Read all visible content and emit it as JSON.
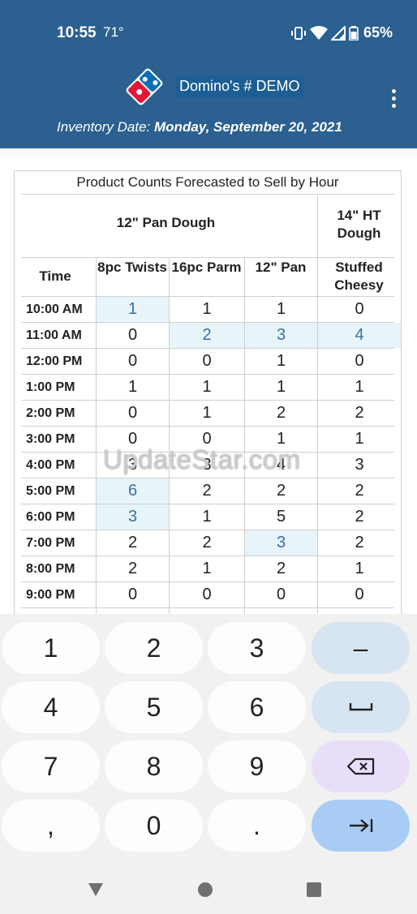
{
  "status_bar": {
    "time": "10:55",
    "temperature": "71°",
    "battery": "65%"
  },
  "header": {
    "store_name": "Domino's # DEMO",
    "inventory_label": "Inventory Date:",
    "inventory_date": "Monday, September 20, 2021"
  },
  "table": {
    "title": "Product Counts Forecasted to Sell by Hour",
    "groups": [
      "12\" Pan Dough",
      "14\" HT Dough"
    ],
    "columns": [
      "Time",
      "8pc Twists",
      "16pc Parm",
      "12\" Pan",
      "Stuffed Cheesy"
    ],
    "rows": [
      {
        "time": "10:00 AM",
        "values": [
          "1",
          "1",
          "1",
          "0"
        ],
        "highlight": [
          true,
          false,
          false,
          false
        ]
      },
      {
        "time": "11:00 AM",
        "values": [
          "0",
          "2",
          "3",
          "4"
        ],
        "highlight": [
          false,
          true,
          true,
          true
        ]
      },
      {
        "time": "12:00 PM",
        "values": [
          "0",
          "0",
          "1",
          "0"
        ],
        "highlight": [
          false,
          false,
          false,
          false
        ]
      },
      {
        "time": "1:00 PM",
        "values": [
          "1",
          "1",
          "1",
          "1"
        ],
        "highlight": [
          false,
          false,
          false,
          false
        ]
      },
      {
        "time": "2:00 PM",
        "values": [
          "0",
          "1",
          "2",
          "2"
        ],
        "highlight": [
          false,
          false,
          false,
          false
        ]
      },
      {
        "time": "3:00 PM",
        "values": [
          "0",
          "0",
          "1",
          "1"
        ],
        "highlight": [
          false,
          false,
          false,
          false
        ]
      },
      {
        "time": "4:00 PM",
        "values": [
          "3",
          "3",
          "4",
          "3"
        ],
        "highlight": [
          false,
          false,
          false,
          false
        ]
      },
      {
        "time": "5:00 PM",
        "values": [
          "6",
          "2",
          "2",
          "2"
        ],
        "highlight": [
          true,
          false,
          false,
          false
        ]
      },
      {
        "time": "6:00 PM",
        "values": [
          "3",
          "1",
          "5",
          "2"
        ],
        "highlight": [
          true,
          false,
          false,
          false
        ]
      },
      {
        "time": "7:00 PM",
        "values": [
          "2",
          "2",
          "3",
          "2"
        ],
        "highlight": [
          false,
          false,
          true,
          false
        ]
      },
      {
        "time": "8:00 PM",
        "values": [
          "2",
          "1",
          "2",
          "1"
        ],
        "highlight": [
          false,
          false,
          false,
          false
        ]
      },
      {
        "time": "9:00 PM",
        "values": [
          "0",
          "0",
          "0",
          "0"
        ],
        "highlight": [
          false,
          false,
          false,
          false
        ]
      }
    ]
  },
  "watermark": "UpdateStar.com",
  "keyboard": {
    "rows": [
      [
        "1",
        "2",
        "3",
        "–"
      ],
      [
        "4",
        "5",
        "6",
        "␣"
      ],
      [
        "7",
        "8",
        "9",
        "⌫"
      ],
      [
        ",",
        "0",
        ".",
        "⇥"
      ]
    ],
    "icons": {
      "space": "space-icon",
      "backspace": "backspace-icon",
      "next": "next-tab-icon"
    }
  },
  "navigation": {
    "icons": [
      "back-triangle-icon",
      "home-circle-icon",
      "recents-square-icon"
    ]
  },
  "colors": {
    "header": "#2b6090",
    "highlight_cell": "#e7f4fa",
    "highlight_text": "#3a6fa3",
    "key_function": "#d7e5f3",
    "key_delete": "#e9defa",
    "key_next": "#a9ccf4"
  }
}
